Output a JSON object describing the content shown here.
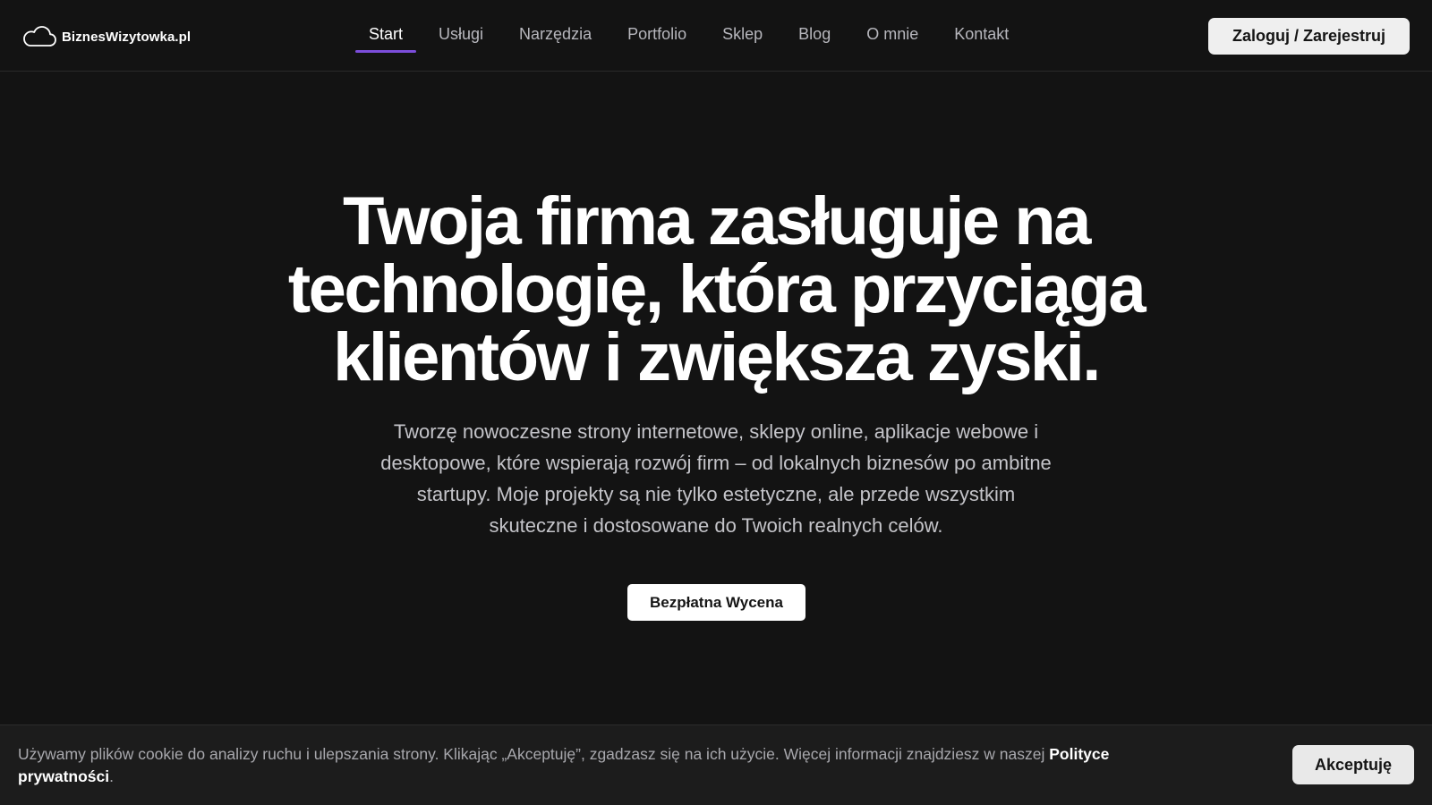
{
  "header": {
    "logo": {
      "icon": "cloud-icon",
      "text": "BiznesWizytowka.pl"
    },
    "nav": [
      {
        "label": "Start",
        "active": true
      },
      {
        "label": "Usługi",
        "active": false
      },
      {
        "label": "Narzędzia",
        "active": false
      },
      {
        "label": "Portfolio",
        "active": false
      },
      {
        "label": "Sklep",
        "active": false
      },
      {
        "label": "Blog",
        "active": false
      },
      {
        "label": "O mnie",
        "active": false
      },
      {
        "label": "Kontakt",
        "active": false
      }
    ],
    "login_label": "Zaloguj / Zarejestruj"
  },
  "hero": {
    "title_lines": [
      "Twoja firma zasługuje na",
      "technologię, która przyciąga",
      "klientów i zwiększa zyski."
    ],
    "subtitle_lines": [
      "Tworzę nowoczesne strony internetowe, sklepy online, aplikacje webowe i",
      "desktopowe, które wspierają rozwój firm – od lokalnych biznesów po ambitne",
      "startupy. Moje projekty są nie tylko estetyczne, ale przede wszystkim",
      "skuteczne i dostosowane do Twoich realnych celów."
    ],
    "cta_label": "Bezpłatna Wycena"
  },
  "cookie": {
    "text": "Używamy plików cookie do analizy ruchu i ulepszania strony. Klikając „Akceptuję”, zgadzasz się na ich użycie. Więcej informacji znajdziesz w naszej ",
    "link_label": "Polityce prywatności",
    "suffix": ".",
    "accept_label": "Akceptuję"
  },
  "colors": {
    "background": "#131313",
    "accent": "#7c4ddb",
    "cookie_bar": "#1c1c1c"
  }
}
